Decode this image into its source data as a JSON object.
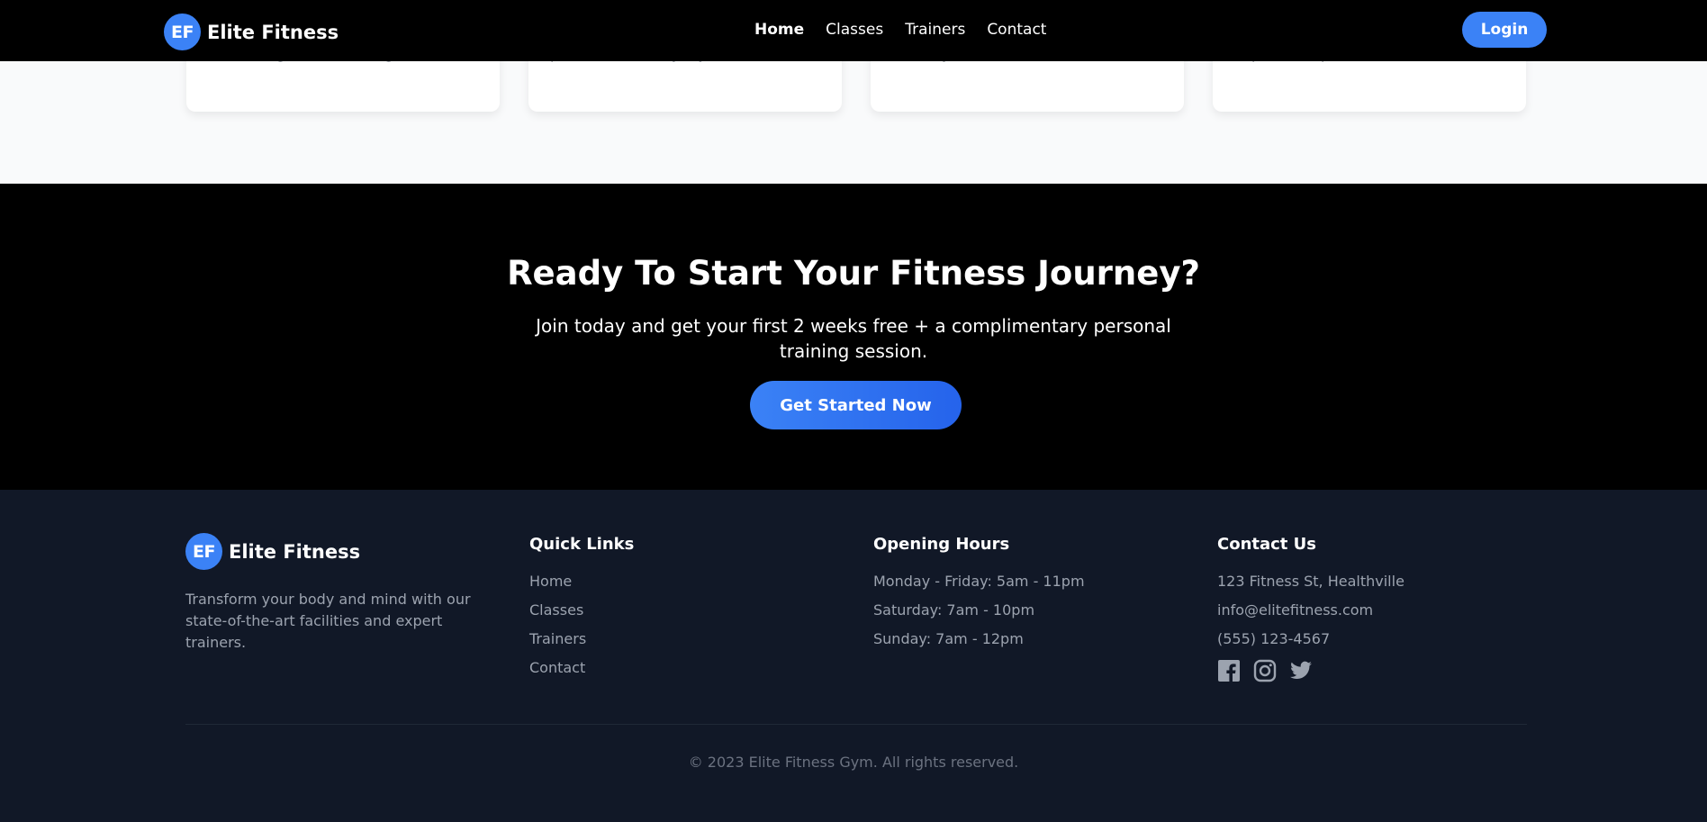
{
  "header": {
    "logo_initials": "EF",
    "brand": "Elite Fitness",
    "nav": [
      "Home",
      "Classes",
      "Trainers",
      "Contact"
    ],
    "login": "Login"
  },
  "cards": [
    {
      "text": "and strength conditioning."
    },
    {
      "text": "patterns for everyday life."
    },
    {
      "text": "mobility, and mindfulness."
    },
    {
      "text": "expert with proven results."
    }
  ],
  "cta": {
    "title": "Ready To Start Your Fitness Journey?",
    "subtitle": "Join today and get your first 2 weeks free + a complimentary personal training session.",
    "button": "Get Started Now"
  },
  "footer": {
    "logo_initials": "EF",
    "brand": "Elite Fitness",
    "about": "Transform your body and mind with our state-of-the-art facilities and expert trainers.",
    "quick_links": {
      "title": "Quick Links",
      "items": [
        "Home",
        "Classes",
        "Trainers",
        "Contact"
      ]
    },
    "hours": {
      "title": "Opening Hours",
      "items": [
        "Monday - Friday: 5am - 11pm",
        "Saturday: 7am - 10pm",
        "Sunday: 7am - 12pm"
      ]
    },
    "contact": {
      "title": "Contact Us",
      "items": [
        "123 Fitness St, Healthville",
        "info@elitefitness.com",
        "(555) 123-4567"
      ]
    },
    "socials": [
      "facebook-icon",
      "instagram-icon",
      "twitter-icon"
    ],
    "copyright": "© 2023 Elite Fitness Gym. All rights reserved."
  },
  "colors": {
    "accent": "#3b82f6",
    "footer_bg": "#111827",
    "cta_bg": "#000000"
  }
}
